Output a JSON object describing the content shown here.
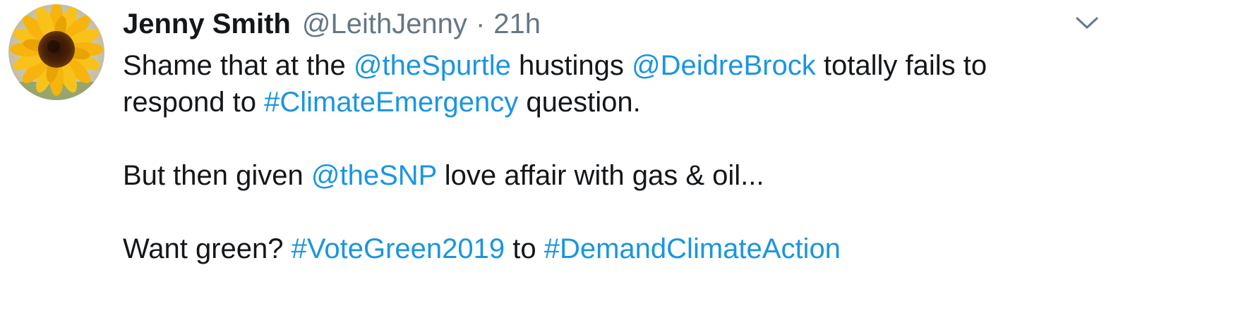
{
  "tweet": {
    "author_name": "Jenny Smith",
    "handle": "@LeithJenny",
    "separator": "·",
    "time": "21h",
    "menu_icon": "chevron-down-icon",
    "avatar_icon": "sunflower-avatar",
    "body": {
      "line1": {
        "t1": "Shame that at the ",
        "m1": "@theSpurtle",
        "t2": " hustings ",
        "m2": "@DeidreBrock",
        "t3": " totally fails to"
      },
      "line2": {
        "t1": "respond to ",
        "h1": "#ClimateEmergency",
        "t2": " question."
      },
      "line3": {
        "t1": "But then given ",
        "m1": "@theSNP",
        "t2": " love affair with gas & oil..."
      },
      "line4": {
        "t1": "Want green? ",
        "h1": "#VoteGreen2019",
        "t2": " to ",
        "h2": "#DemandClimateAction"
      }
    }
  },
  "colors": {
    "text": "#14171a",
    "secondary": "#657786",
    "link": "#1b95e0",
    "background": "#ffffff"
  }
}
